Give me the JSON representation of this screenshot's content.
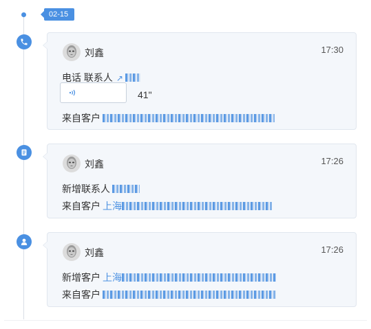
{
  "timeline": {
    "date_label": "02-15"
  },
  "entries": [
    {
      "type_icon": "phone-icon",
      "author": "刘鑫",
      "time": "17:30",
      "lines": [
        {
          "label": "电话 联系人"
        },
        {
          "label": "来自客户"
        }
      ],
      "audio_duration": "41\""
    },
    {
      "type_icon": "notebook-icon",
      "author": "刘鑫",
      "time": "17:26",
      "lines": [
        {
          "label": "新增联系人"
        },
        {
          "label": "来自客户"
        }
      ],
      "masked_prefix": "上海"
    },
    {
      "type_icon": "person-icon",
      "author": "刘鑫",
      "time": "17:26",
      "lines": [
        {
          "label": "新增客户"
        },
        {
          "label": "来自客户"
        }
      ],
      "masked_prefix": "上海"
    }
  ],
  "colors": {
    "accent": "#4a90e2",
    "card_background": "#f4f7fb",
    "card_border": "#e0e6ee"
  }
}
